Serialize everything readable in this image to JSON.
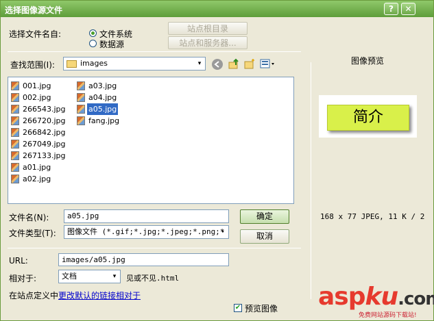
{
  "window": {
    "title": "选择图像源文件",
    "help_label": "?",
    "close_label": "✕"
  },
  "source": {
    "label": "选择文件名自:",
    "options": [
      {
        "label": "文件系统",
        "selected": true
      },
      {
        "label": "数据源",
        "selected": false
      }
    ],
    "site_root_button": "站点根目录",
    "site_server_button": "站点和服务器..."
  },
  "lookin": {
    "label": "查找范围(I):",
    "folder_icon": "folder-icon",
    "value": "images",
    "arrow": "▾"
  },
  "toolbar_icons": [
    "back-icon",
    "up-folder-icon",
    "new-folder-icon",
    "view-menu-icon"
  ],
  "files": {
    "column1": [
      "001.jpg",
      "002.jpg",
      "266543.jpg",
      "266720.jpg",
      "266842.jpg",
      "267049.jpg",
      "267133.jpg",
      "a01.jpg",
      "a02.jpg"
    ],
    "column2": [
      "a03.jpg",
      "a04.jpg",
      "a05.jpg",
      "fang.jpg"
    ],
    "selected": "a05.jpg"
  },
  "filename": {
    "label": "文件名(N):",
    "value": "a05.jpg"
  },
  "filetype": {
    "label": "文件类型(T):",
    "value": "图像文件 (*.gif;*.jpg;*.jpeg;*.png;*"
  },
  "buttons": {
    "ok": "确定",
    "cancel": "取消"
  },
  "url": {
    "label": "URL:",
    "value": "images/a05.jpg"
  },
  "relative": {
    "label": "相对于:",
    "value": "文档",
    "note": "见或不见.html"
  },
  "site_def": {
    "prefix": "在站点定义中",
    "link": "更改默认的链接相对于"
  },
  "preview": {
    "heading": "图像预览",
    "image_text": "简介",
    "info": "168 x 77 JPEG, 11 K / 2",
    "checkbox_label": "预览图像",
    "checkbox_checked": true
  },
  "watermark": {
    "asp": "asp",
    "ku": "ku",
    "com": ".com",
    "sub": "免费网站源码下载站!"
  }
}
